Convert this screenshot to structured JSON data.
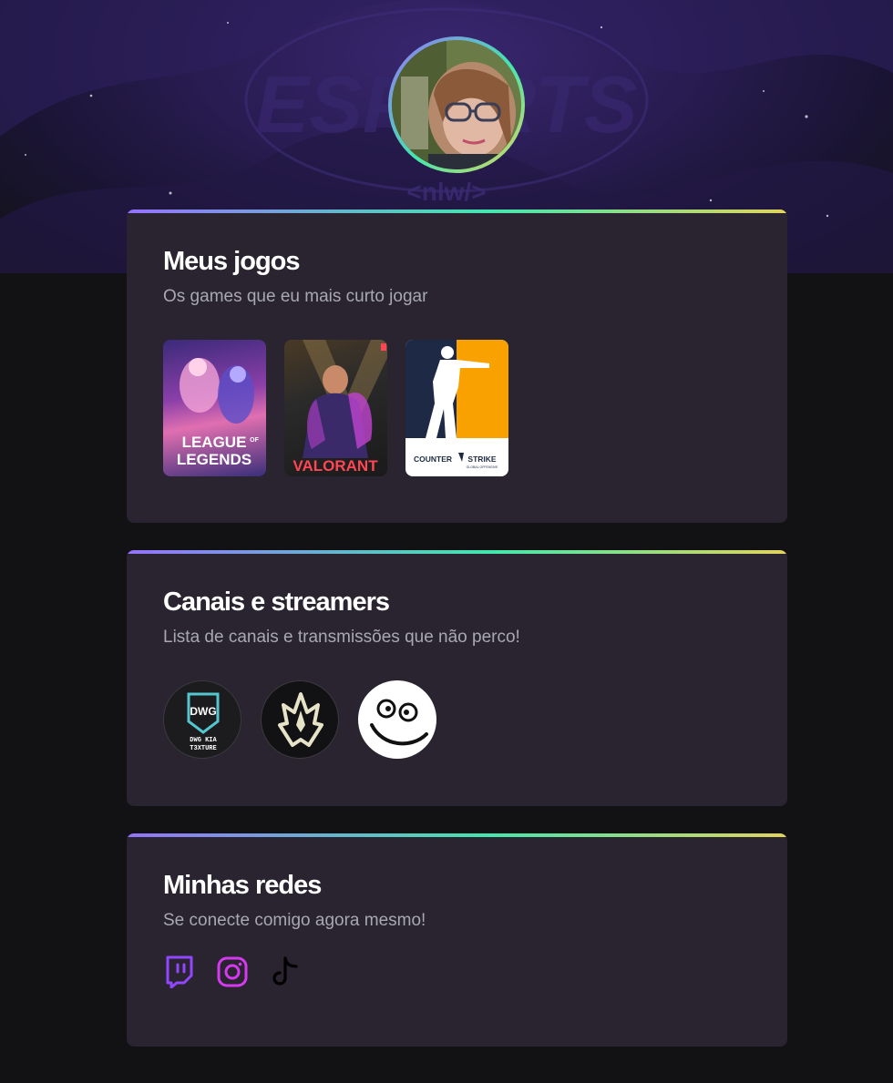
{
  "hero": {
    "background_logo_text": "ESPORTS",
    "background_logo_sub": "<nlw/>"
  },
  "profile": {
    "avatar_icon": "profile-photo",
    "ring_gradient": [
      "#9572fc",
      "#43e7ad",
      "#e2d45c"
    ]
  },
  "games_section": {
    "title": "Meus jogos",
    "subtitle": "Os games que eu mais curto jogar",
    "games": [
      {
        "name": "League of Legends",
        "logo_line1": "LEAGUE",
        "logo_of": "OF",
        "logo_line2": "LEGENDS"
      },
      {
        "name": "Valorant",
        "logo": "VALORANT"
      },
      {
        "name": "Counter-Strike",
        "logo_left": "COUNTER",
        "logo_right": "STRIKE",
        "logo_sub": "GLOBAL OFFENSIVE"
      }
    ]
  },
  "channels_section": {
    "title": "Canais e streamers",
    "subtitle": "Lista de canais e transmissões que não perco!",
    "channels": [
      {
        "name": "DWG KIA T3XTURE",
        "mark": "DWG",
        "line1": "DWG KIA",
        "line2": "T3XTURE"
      },
      {
        "name": "flame-crest channel",
        "icon": "flame-crest-icon"
      },
      {
        "name": "smiley channel",
        "icon": "smiley-face-icon"
      }
    ]
  },
  "socials_section": {
    "title": "Minhas redes",
    "subtitle": "Se conecte comigo agora mesmo!",
    "links": [
      {
        "name": "Twitch",
        "icon": "twitch-icon",
        "color": "#9146ff"
      },
      {
        "name": "Instagram",
        "icon": "instagram-icon",
        "color": "#d63af0"
      },
      {
        "name": "TikTok",
        "icon": "tiktok-icon",
        "color": "#000000"
      }
    ]
  },
  "colors": {
    "page_bg": "#121214",
    "card_bg": "#29242f",
    "text_primary": "#ffffff",
    "text_secondary": "#a8a8b3"
  }
}
